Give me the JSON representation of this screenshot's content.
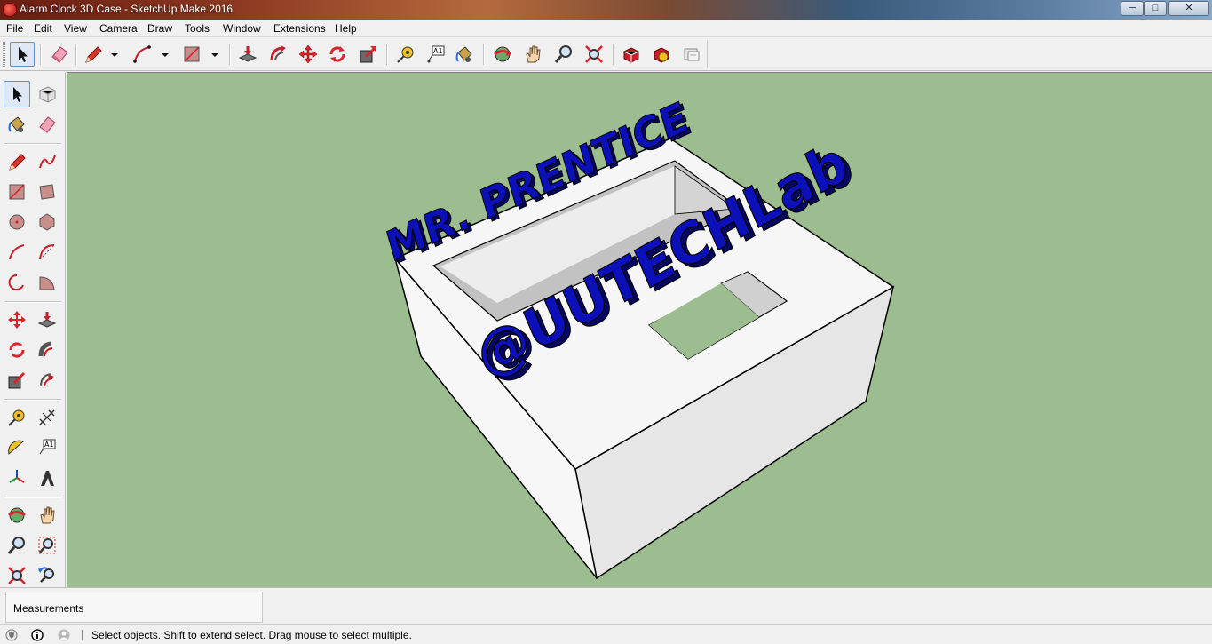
{
  "window": {
    "title": "Alarm Clock 3D Case - SketchUp Make 2016",
    "minimize": "─",
    "maximize": "□",
    "close": "✕"
  },
  "menu": [
    "File",
    "Edit",
    "View",
    "Camera",
    "Draw",
    "Tools",
    "Window",
    "Extensions",
    "Help"
  ],
  "toolbar": {
    "tools": [
      "select",
      "eraser",
      "pencil",
      "arc",
      "rectangle",
      "push-pull",
      "follow-me",
      "move",
      "rotate",
      "scale",
      "tape-measure",
      "text",
      "paint-bucket",
      "orbit",
      "pan",
      "zoom",
      "zoom-extents",
      "3d-warehouse",
      "extension-warehouse",
      "layout"
    ],
    "text_tool_glyph": "A1"
  },
  "palette": {
    "tools": [
      "select",
      "make-component",
      "paint-bucket",
      "eraser",
      "pencil",
      "freehand",
      "rectangle",
      "rotated-rectangle",
      "circle",
      "polygon",
      "arc",
      "two-point-arc",
      "three-point-arc",
      "pie",
      "move",
      "push-pull",
      "rotate",
      "follow-me",
      "scale",
      "offset",
      "tape-measure",
      "dimensions",
      "protractor",
      "text",
      "axes",
      "3d-text",
      "orbit",
      "pan",
      "zoom",
      "zoom-window",
      "zoom-extents",
      "previous-view"
    ],
    "text_tool_glyph": "A1"
  },
  "model": {
    "text_front": "@UUTECHLab",
    "text_back": "MR. PRENTICE",
    "text_color": "#0c10b8",
    "body_color": "#ececec",
    "background_color": "#9bbd8f"
  },
  "measurements": {
    "label": "Measurements",
    "value": ""
  },
  "status": {
    "text": "Select objects. Shift to extend select. Drag mouse to select multiple.",
    "icons": [
      "geo-location-icon",
      "credits-icon",
      "user-icon"
    ]
  },
  "colors": {
    "viewport": "#9bbd8f",
    "chrome": "#f0f0f0",
    "selected": "#dde8f4"
  }
}
